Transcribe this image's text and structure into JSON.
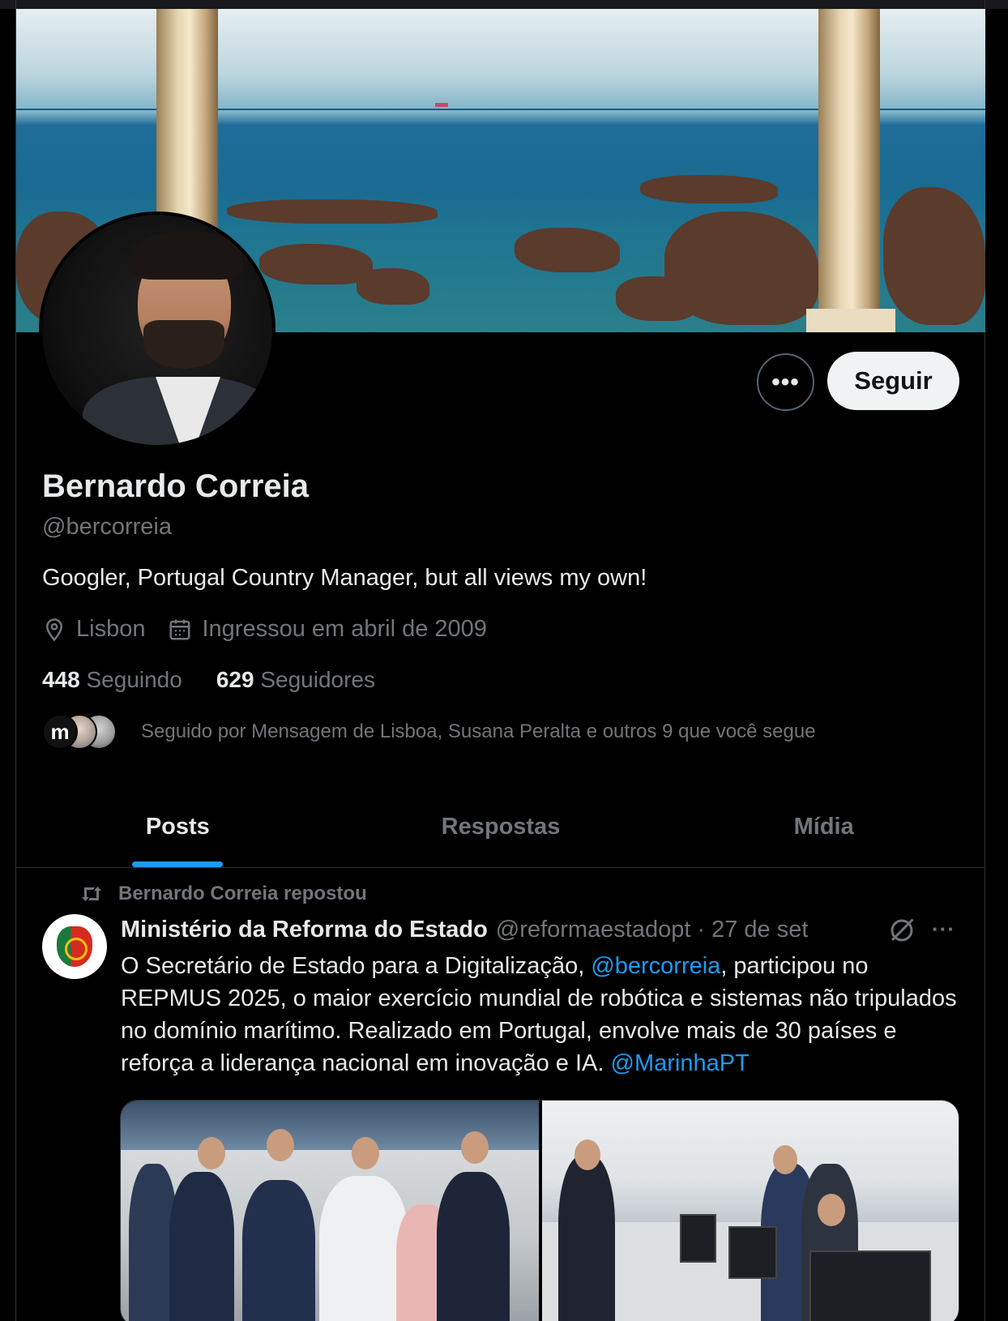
{
  "profile": {
    "name": "Bernardo Correia",
    "handle": "@bercorreia",
    "bio": "Googler, Portugal Country Manager, but all views my own!",
    "location": "Lisbon",
    "joined": "Ingressou em abril de 2009",
    "following_count": "448",
    "following_label": "Seguindo",
    "followers_count": "629",
    "followers_label": "Seguidores",
    "followed_by": "Seguido por Mensagem de Lisboa, Susana Peralta e outros 9 que você segue"
  },
  "actions": {
    "more_label": "•••",
    "follow_label": "Seguir"
  },
  "tabs": [
    {
      "label": "Posts",
      "active": true
    },
    {
      "label": "Respostas",
      "active": false
    },
    {
      "label": "Mídia",
      "active": false
    }
  ],
  "post": {
    "repost_label": "Bernardo Correia repostou",
    "author": "Ministério da Reforma do Estado",
    "handle": "@reformaestadopt",
    "separator": "·",
    "date": "27 de set",
    "more_label": "···",
    "text_1": "O Secretário de Estado para a Digitalização, ",
    "mention_1": "@bercorreia",
    "text_2": ", participou no REPMUS 2025, o maior exercício mundial de robótica e sistemas não tripulados no domínio marítimo. Realizado em Portugal, envolve mais de 30 países e reforça a liderança nacional em inovação e IA. ",
    "mention_2": "@MarinhaPT"
  },
  "mini_avatar_letter": "m",
  "colors": {
    "background": "#000000",
    "text_primary": "#e7e9ea",
    "text_secondary": "#71767b",
    "accent": "#1d9bf0",
    "follow_button_bg": "#eff3f4"
  }
}
